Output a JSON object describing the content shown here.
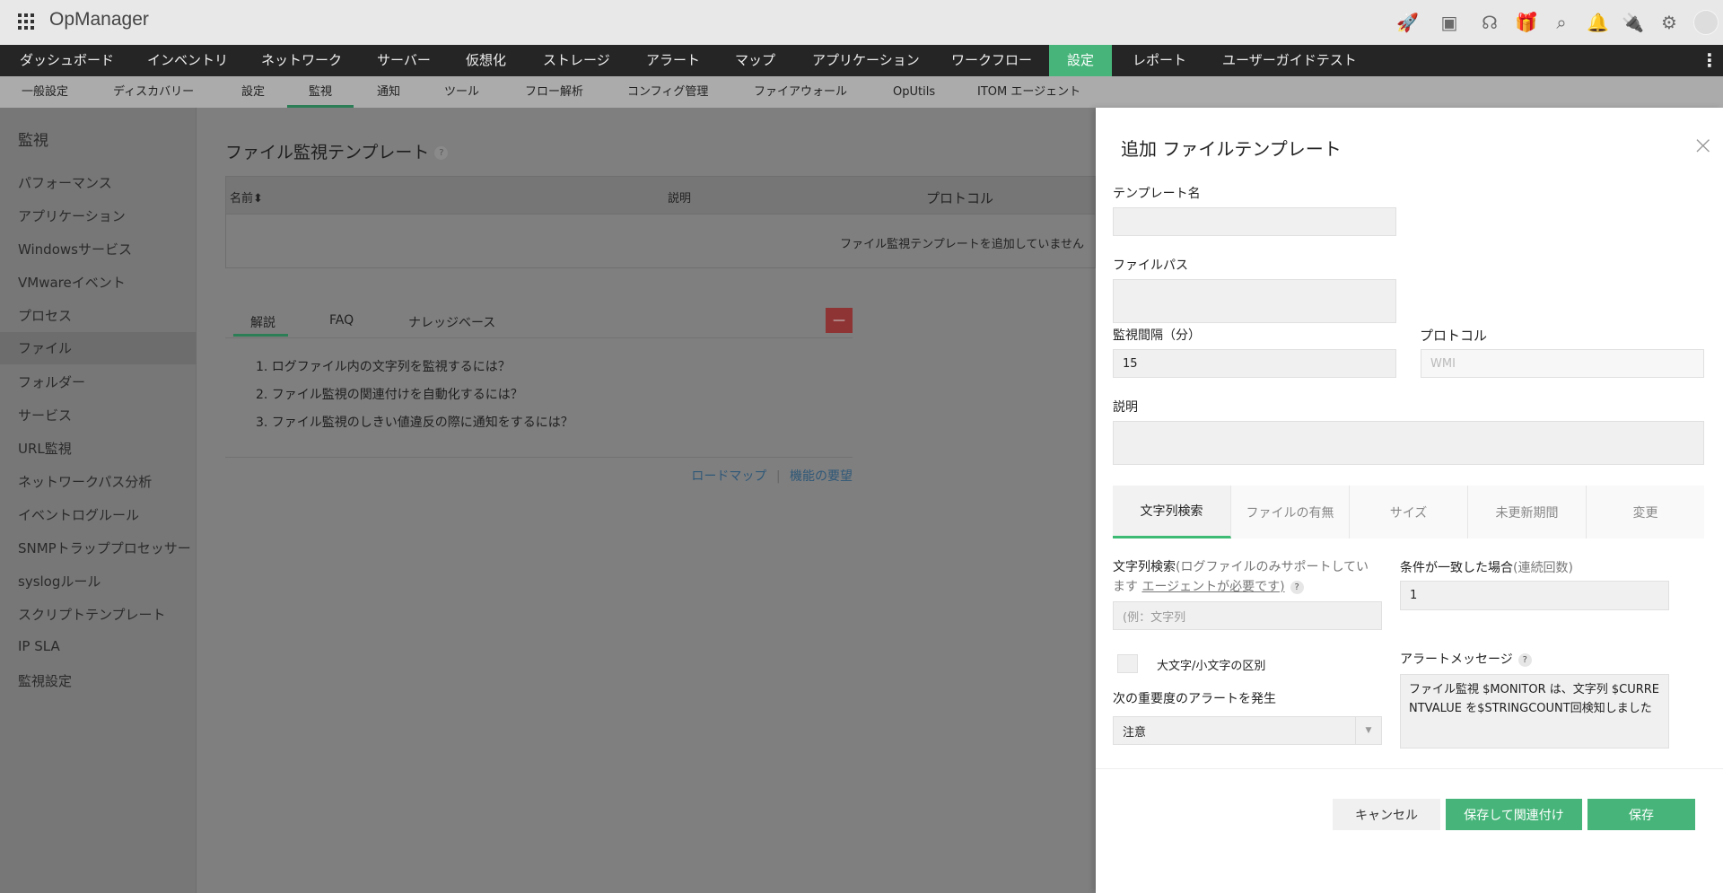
{
  "app": {
    "title": "OpManager"
  },
  "topicons": [
    "rocket-icon",
    "presentation-icon",
    "headset-icon",
    "gift-icon",
    "search-icon",
    "bell-icon",
    "plug-icon",
    "gear-icon",
    "avatar"
  ],
  "mainnav": [
    "ダッシュボード",
    "インベントリ",
    "ネットワーク",
    "サーバー",
    "仮想化",
    "ストレージ",
    "アラート",
    "マップ",
    "アプリケーション",
    "ワークフロー",
    "設定",
    "レポート",
    "ユーザーガイドテスト"
  ],
  "subnav": [
    "一般設定",
    "ディスカバリー",
    "設定",
    "監視",
    "通知",
    "ツール",
    "フロー解析",
    "コンフィグ管理",
    "ファイアウォール",
    "OpUtils",
    "ITOM エージェント"
  ],
  "sidebar": {
    "title": "監視",
    "items": [
      "パフォーマンス",
      "アプリケーション",
      "Windowsサービス",
      "VMwareイベント",
      "プロセス",
      "ファイル",
      "フォルダー",
      "サービス",
      "URL監視",
      "ネットワークパス分析",
      "イベントログルール",
      "SNMPトラッププロセッサー",
      "syslogルール",
      "スクリプトテンプレート",
      "IP SLA",
      "監視設定"
    ]
  },
  "main": {
    "title": "ファイル監視テンプレート",
    "help": "?",
    "columns": [
      "名前",
      "説明",
      "プロトコル"
    ],
    "empty": "ファイル監視テンプレートを追加していません",
    "tabs": [
      "解説",
      "FAQ",
      "ナレッジベース"
    ],
    "collapse": "—",
    "questions": [
      "1. ログファイル内の文字列を監視するには？",
      "2. ファイル監視の関連付けを自動化するには？",
      "3. ファイル監視のしきい値違反の際に通知をするには？"
    ],
    "links": {
      "roadmap": "ロードマップ",
      "sep": "|",
      "request": "機能の要望"
    }
  },
  "panel": {
    "title": "追加 ファイルテンプレート",
    "close": "×",
    "template_name": {
      "label": "テンプレート名",
      "value": ""
    },
    "file_path": {
      "label": "ファイルパス",
      "value": ""
    },
    "interval": {
      "label": "監視間隔（分）",
      "value": "15"
    },
    "protocol": {
      "label": "プロトコル",
      "value": "WMI"
    },
    "description": {
      "label": "説明",
      "value": ""
    },
    "tabs": [
      "文字列検索",
      "ファイルの有無",
      "サイズ",
      "未更新期間",
      "変更"
    ],
    "string_search": {
      "label": "文字列検索",
      "note1": "(ログファイルのみサポートしてい",
      "note2": "ます",
      "link": "エージェントが必要です)",
      "placeholder": "(例：文字列"
    },
    "condition": {
      "label": "条件が一致した場合",
      "note": "(連続回数)",
      "value": "1"
    },
    "case_label": "大文字/小文字の区別",
    "severity": {
      "label": "次の重要度のアラートを発生",
      "value": "注意"
    },
    "alert_message": {
      "label": "アラートメッセージ",
      "value": "ファイル監視 $MONITOR は、文字列 $CURRENTVALUE を$STRINGCOUNT回検知しました"
    },
    "buttons": {
      "cancel": "キャンセル",
      "save_assoc": "保存して関連付け",
      "save": "保存"
    }
  },
  "colors": {
    "accent": "#47b57a",
    "nav": "#252525"
  }
}
